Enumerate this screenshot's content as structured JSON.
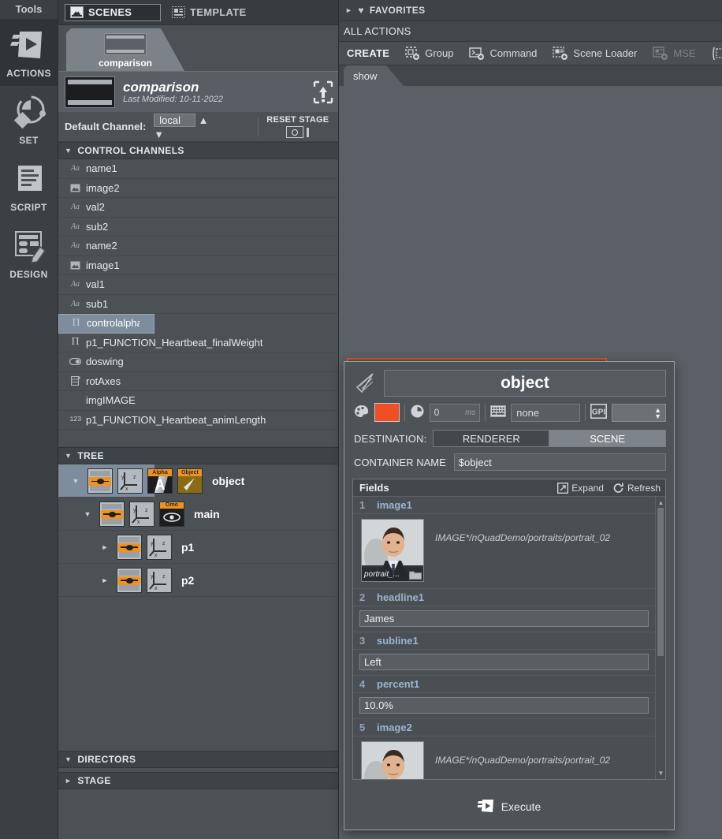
{
  "rail": {
    "title": "Tools",
    "items": [
      {
        "label": "ACTIONS",
        "icon": "actions-icon",
        "active": true
      },
      {
        "label": "SET",
        "icon": "set-icon",
        "active": false
      },
      {
        "label": "SCRIPT",
        "icon": "script-icon",
        "active": false
      },
      {
        "label": "DESIGN",
        "icon": "design-icon",
        "active": false
      }
    ]
  },
  "scenes_panel": {
    "tabs": [
      {
        "label": "SCENES",
        "icon": "scenes-icon",
        "selected": true
      },
      {
        "label": "TEMPLATE",
        "icon": "template-icon",
        "selected": false
      }
    ],
    "scene_tab": {
      "name": "comparison"
    },
    "scene_info": {
      "title": "comparison",
      "subtitle": "Last Modified: 10-11-2022",
      "upload_icon": "upload-icon"
    },
    "default_channel": {
      "label": "Default Channel:",
      "value": "local",
      "options": [
        "local"
      ]
    },
    "reset_stage": {
      "label": "RESET STAGE"
    },
    "control_channels": {
      "header": "CONTROL CHANNELS",
      "expanded": true,
      "items": [
        {
          "name": "name1",
          "icon": "text-icon",
          "selected": false
        },
        {
          "name": "image2",
          "icon": "image-icon",
          "selected": false
        },
        {
          "name": "val2",
          "icon": "text-icon",
          "selected": false
        },
        {
          "name": "sub2",
          "icon": "text-icon",
          "selected": false
        },
        {
          "name": "name2",
          "icon": "text-icon",
          "selected": false
        },
        {
          "name": "image1",
          "icon": "image-icon",
          "selected": false
        },
        {
          "name": "val1",
          "icon": "text-icon",
          "selected": false
        },
        {
          "name": "sub1",
          "icon": "text-icon",
          "selected": false
        },
        {
          "name": "controlalpha",
          "icon": "pi-icon",
          "selected": true
        },
        {
          "name": "p1_FUNCTION_Heartbeat_finalWeight",
          "icon": "pi-icon",
          "selected": false
        },
        {
          "name": "doswing",
          "icon": "toggle-icon",
          "selected": false
        },
        {
          "name": "rotAxes",
          "icon": "list-icon",
          "selected": false
        },
        {
          "name": "imgIMAGE",
          "icon": "none-icon",
          "selected": false
        },
        {
          "name": "p1_FUNCTION_Heartbeat_animLength",
          "icon": "number-icon",
          "selected": false
        }
      ]
    },
    "tree": {
      "header": "TREE",
      "expanded": true,
      "nodes": [
        {
          "label": "object",
          "depth": 0,
          "caret": "down",
          "selected": true,
          "icons": [
            "eye-icon",
            "axis-icon",
            "alpha-icon",
            "object-icon"
          ],
          "badges": [
            "Alpha",
            "Object"
          ]
        },
        {
          "label": "main",
          "depth": 1,
          "caret": "down",
          "selected": false,
          "icons": [
            "eye-icon",
            "axis-icon",
            "omo-icon"
          ],
          "badges": [
            "Omo"
          ]
        },
        {
          "label": "p1",
          "depth": 2,
          "caret": "right",
          "selected": false,
          "icons": [
            "eye-icon",
            "axis-icon"
          ],
          "badges": []
        },
        {
          "label": "p2",
          "depth": 2,
          "caret": "right",
          "selected": false,
          "icons": [
            "eye-icon",
            "axis-icon"
          ],
          "badges": []
        }
      ]
    },
    "directors": {
      "header": "DIRECTORS",
      "expanded": true
    },
    "stage": {
      "header": "STAGE",
      "expanded": false
    }
  },
  "right_panel": {
    "favorites": {
      "label": "FAVORITES",
      "expanded": false,
      "icon": "heart-icon"
    },
    "all_actions": "ALL ACTIONS",
    "create_bar": {
      "title": "CREATE",
      "buttons": [
        {
          "label": "Group",
          "icon": "group-icon",
          "disabled": false
        },
        {
          "label": "Command",
          "icon": "command-icon",
          "disabled": false
        },
        {
          "label": "Scene Loader",
          "icon": "scene-loader-icon",
          "disabled": false
        },
        {
          "label": "MSE",
          "icon": "mse-icon",
          "disabled": true
        }
      ]
    },
    "show_tab": "show"
  },
  "dialog": {
    "title": "object",
    "cone_icon": "cone-icon",
    "color_swatch": "#f04e23",
    "palette_icon": "palette-icon",
    "clock_icon": "clock-icon",
    "delay_value": "0",
    "delay_unit": "ms",
    "keyboard_icon": "keyboard-icon",
    "shortcut_value": "none",
    "gpi_icon": "gpi-icon",
    "gpi_value": "",
    "destination": {
      "label": "DESTINATION:",
      "options": [
        "RENDERER",
        "SCENE"
      ],
      "selected": "SCENE"
    },
    "container_name": {
      "label": "CONTAINER NAME",
      "value": "$object"
    },
    "fields": {
      "header": "Fields",
      "expand_label": "Expand",
      "expand_icon": "expand-icon",
      "refresh_label": "Refresh",
      "refresh_icon": "refresh-icon",
      "rows": [
        {
          "index": "1",
          "name": "image1",
          "type": "image",
          "path": "IMAGE*/nQuadDemo/portraits/portrait_02",
          "thumb_caption": "portrait_...",
          "folder_icon": "folder-icon"
        },
        {
          "index": "2",
          "name": "headline1",
          "type": "text",
          "value": "James"
        },
        {
          "index": "3",
          "name": "subline1",
          "type": "text",
          "value": "Left"
        },
        {
          "index": "4",
          "name": "percent1",
          "type": "text",
          "value": "10.0%"
        },
        {
          "index": "5",
          "name": "image2",
          "type": "image",
          "path": "IMAGE*/nQuadDemo/portraits/portrait_02",
          "thumb_caption": "",
          "folder_icon": "folder-icon"
        }
      ]
    },
    "execute": {
      "label": "Execute",
      "icon": "execute-icon"
    }
  }
}
